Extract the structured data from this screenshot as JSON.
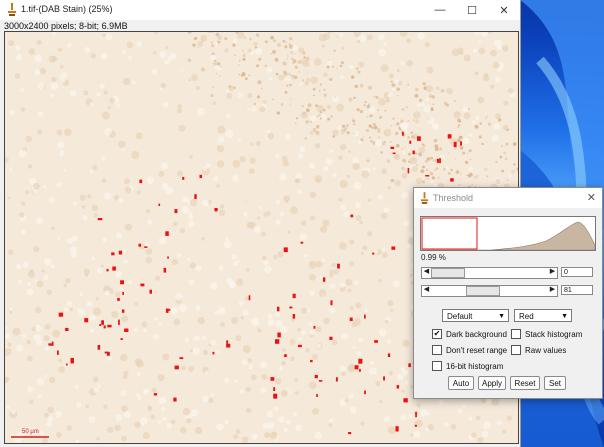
{
  "image_window": {
    "title": "1.tif-(DAB Stain) (25%)",
    "info": "3000x2400 pixels; 8-bit; 6.9MB",
    "scalebar_label": "50 µm"
  },
  "window_controls": {
    "minimize": "—",
    "maximize": "☐",
    "close": "✕"
  },
  "threshold": {
    "title": "Threshold",
    "percent": "0.99 %",
    "min_value": "0",
    "max_value": "81",
    "method": "Default",
    "display_mode": "Red",
    "options": {
      "dark_background": {
        "label": "Dark background",
        "checked": true
      },
      "stack_histogram": {
        "label": "Stack histogram",
        "checked": false
      },
      "dont_reset_range": {
        "label": "Don't reset range",
        "checked": false
      },
      "raw_values": {
        "label": "Raw values",
        "checked": false
      },
      "sixteen_bit": {
        "label": "16-bit histogram",
        "checked": false
      }
    },
    "buttons": {
      "auto": "Auto",
      "apply": "Apply",
      "reset": "Reset",
      "set": "Set"
    },
    "close_glyph": "✕"
  },
  "colors": {
    "threshold_red": "#ee1111",
    "histogram_fill": "#c8b6a2",
    "tissue_background": "#f5e9da",
    "tissue_stain": "#d9b48c"
  }
}
